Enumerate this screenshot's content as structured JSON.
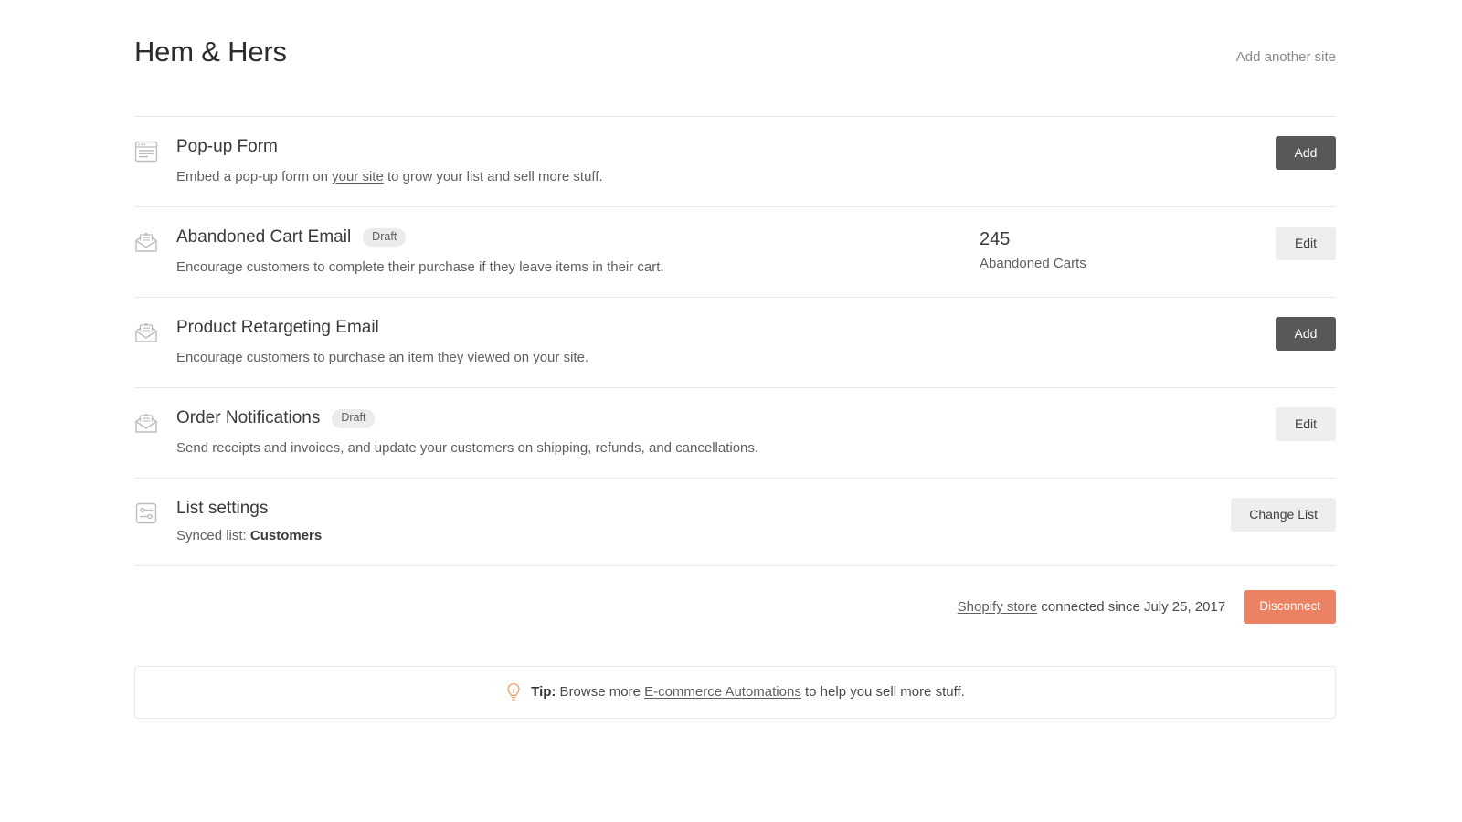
{
  "header": {
    "site_title": "Hem & Hers",
    "add_site_label": "Add another site"
  },
  "rows": [
    {
      "icon": "popup-form-icon",
      "title": "Pop-up Form",
      "badge": "",
      "desc_before": "Embed a pop-up form on ",
      "desc_link": "your site",
      "desc_after": " to grow your list and sell more stuff.",
      "stat_value": "",
      "stat_label": "",
      "action_label": "Add",
      "action_style": "dark"
    },
    {
      "icon": "email-icon",
      "title": "Abandoned Cart Email",
      "badge": "Draft",
      "desc_before": "Encourage customers to complete their purchase if they leave items in their cart.",
      "desc_link": "",
      "desc_after": "",
      "stat_value": "245",
      "stat_label": "Abandoned Carts",
      "action_label": "Edit",
      "action_style": "light"
    },
    {
      "icon": "email-icon",
      "title": "Product Retargeting Email",
      "badge": "",
      "desc_before": "Encourage customers to purchase an item they viewed on ",
      "desc_link": "your site",
      "desc_after": ".",
      "stat_value": "",
      "stat_label": "",
      "action_label": "Add",
      "action_style": "dark"
    },
    {
      "icon": "email-icon",
      "title": "Order Notifications",
      "badge": "Draft",
      "desc_before": "Send receipts and invoices, and update your customers on shipping, refunds, and cancellations.",
      "desc_link": "",
      "desc_after": "",
      "stat_value": "",
      "stat_label": "",
      "action_label": "Edit",
      "action_style": "light"
    }
  ],
  "list_settings": {
    "icon": "sliders-icon",
    "title": "List settings",
    "synced_prefix": "Synced list: ",
    "synced_value": "Customers",
    "action_label": "Change List"
  },
  "connection": {
    "store_link": "Shopify store",
    "status_text": " connected since July 25, 2017",
    "disconnect_label": "Disconnect"
  },
  "tip": {
    "icon": "lightbulb-icon",
    "prefix": "Tip:",
    "middle": " Browse more ",
    "link": "E-commerce Automations",
    "suffix": " to help you sell more stuff."
  },
  "colors": {
    "accent_coral": "#ea8263",
    "button_dark": "#585858",
    "button_light": "#eeeeee",
    "badge_bg": "#ececec",
    "tip_bulb": "#e8a36a",
    "divider": "#e8e8e8"
  }
}
